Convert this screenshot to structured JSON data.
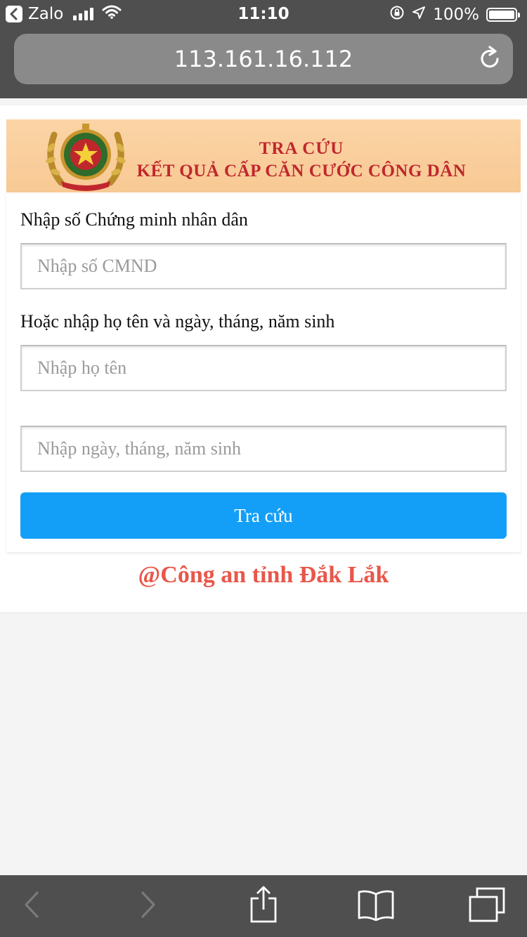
{
  "status_bar": {
    "app_name": "Zalo",
    "time": "11:10",
    "battery_percent": "100%"
  },
  "browser": {
    "url": "113.161.16.112"
  },
  "banner": {
    "title_line1": "TRA CỨU",
    "title_line2": "KẾT QUẢ CẤP CĂN CƯỚC CÔNG DÂN"
  },
  "form": {
    "id_label": "Nhập số Chứng minh nhân dân",
    "id_placeholder": "Nhập số CMND",
    "alt_label": "Hoặc nhập họ tên và ngày, tháng, năm sinh",
    "name_placeholder": "Nhập họ tên",
    "dob_placeholder": "Nhập ngày, tháng, năm sinh",
    "submit_label": "Tra cứu"
  },
  "footer": {
    "credit": "@Công an tỉnh Đắk Lắk"
  },
  "colors": {
    "accent_button": "#139ff7",
    "banner_text": "#c0272d",
    "credit_text": "#e8574a"
  }
}
